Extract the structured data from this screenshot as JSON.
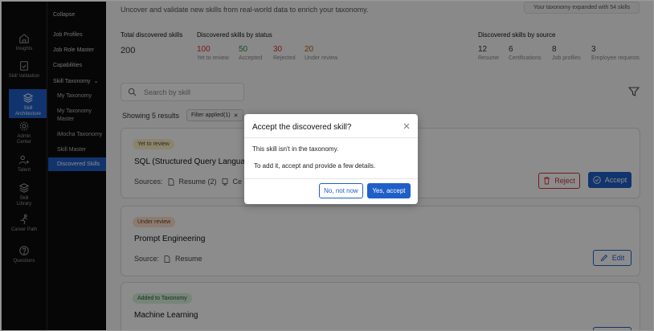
{
  "rail": {
    "items": [
      {
        "label": "Insights",
        "icon": "home-icon"
      },
      {
        "label": "Skill Validation",
        "icon": "clipboard-check-icon"
      },
      {
        "label": "Skill Architecture",
        "icon": "layers-icon"
      },
      {
        "label": "Admin Center",
        "icon": "gear-icon"
      },
      {
        "label": "Talent",
        "icon": "users-icon"
      },
      {
        "label": "Skill Library",
        "icon": "stack-icon"
      },
      {
        "label": "Career Path",
        "icon": "runner-icon"
      },
      {
        "label": "Questions",
        "icon": "question-icon"
      }
    ]
  },
  "menu": {
    "collapse": "Collapse",
    "job_profiles": "Job Profiles",
    "job_role_master": "Job Role Master",
    "capabilities": "Capabilities",
    "skill_taxonomy": "Skill Taxonomy",
    "my_taxonomy": "My Taxonomy",
    "my_taxonomy_master": "My Taxonomy Master",
    "imocha_taxonomy": "iMocha Taxonomy",
    "skill_master": "Skill Master",
    "discovered_skills": "Discovered Skills"
  },
  "main": {
    "intro": "Uncover and validate new skills from real-world data to enrich your taxonomy.",
    "expanded_badge": "Your taxonomy expanded with 54 skills",
    "total": {
      "label": "Total discovered skills",
      "value": "200"
    },
    "by_status": {
      "label": "Discovered skills by status",
      "items": [
        {
          "value": "100",
          "label": "Yet to review",
          "color": "#d93025"
        },
        {
          "value": "50",
          "label": "Accepted",
          "color": "#1e8e3e"
        },
        {
          "value": "30",
          "label": "Rejected",
          "color": "#d93025"
        },
        {
          "value": "20",
          "label": "Under review",
          "color": "#b06000"
        }
      ]
    },
    "by_source": {
      "label": "Discovered skills by source",
      "items": [
        {
          "value": "12",
          "label": "Resume"
        },
        {
          "value": "6",
          "label": "Certifications"
        },
        {
          "value": "8",
          "label": "Job profiles"
        },
        {
          "value": "3",
          "label": "Employee requests"
        }
      ]
    },
    "search_placeholder": "Search by skill",
    "showing": "Showing 5 results",
    "filter_chip": "Filter applied(1)",
    "cards": [
      {
        "badge": "Yet to review",
        "title": "SQL (Structured Query Language)",
        "sources_label": "Sources:",
        "sources": [
          "Resume (2)",
          "Ce"
        ],
        "reject": "Reject",
        "accept": "Accept"
      },
      {
        "badge": "Under review",
        "title": "Prompt Engineering",
        "sources_label": "Source:",
        "sources": [
          "Resume"
        ],
        "edit": "Edit"
      },
      {
        "badge": "Added to Taxonomy",
        "title": "Machine Learning"
      }
    ]
  },
  "modal": {
    "title": "Accept the discovered skill?",
    "line1": "This skill isn't in the taxonomy.",
    "line2": "To add it, accept and provide a few details.",
    "no": "No, not now",
    "yes": "Yes, accept"
  }
}
